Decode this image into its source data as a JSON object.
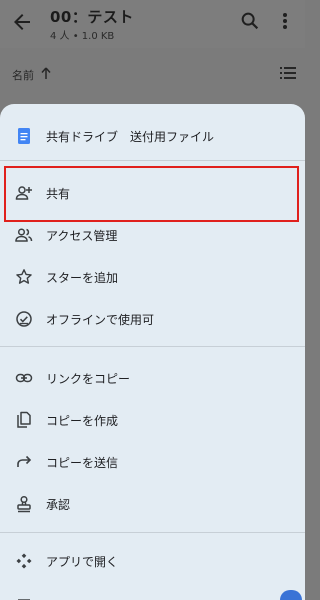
{
  "appbar": {
    "title": "00：テスト",
    "subtitle": "4 人 • 1.0 KB",
    "icons": [
      "back-arrow-icon",
      "search-icon",
      "more-vert-icon"
    ]
  },
  "sortbar": {
    "label": "名前",
    "icons": [
      "arrow-up-icon",
      "list-view-icon"
    ]
  },
  "sheet": {
    "header": {
      "label": "共有ドライブ　送付用ファイル",
      "icon": "doc-icon"
    },
    "items": [
      {
        "label": "共有",
        "icon": "person-add-icon"
      },
      {
        "label": "アクセス管理",
        "icon": "people-icon"
      },
      {
        "label": "スターを追加",
        "icon": "star-outline-icon"
      },
      {
        "label": "オフラインで使用可",
        "icon": "offline-check-icon"
      },
      {
        "label": "リンクをコピー",
        "icon": "link-icon"
      },
      {
        "label": "コピーを作成",
        "icon": "copy-file-icon"
      },
      {
        "label": "コピーを送信",
        "icon": "forward-arrow-icon"
      },
      {
        "label": "承認",
        "icon": "approval-stamp-icon"
      },
      {
        "label": "アプリで開く",
        "icon": "open-with-icon"
      }
    ]
  },
  "colors": {
    "highlight_border": "#e0201c",
    "doc_icon": "#4285f4",
    "sheet_bg": "#e3ecf3",
    "dim_overlay": "#7b7b7b"
  }
}
